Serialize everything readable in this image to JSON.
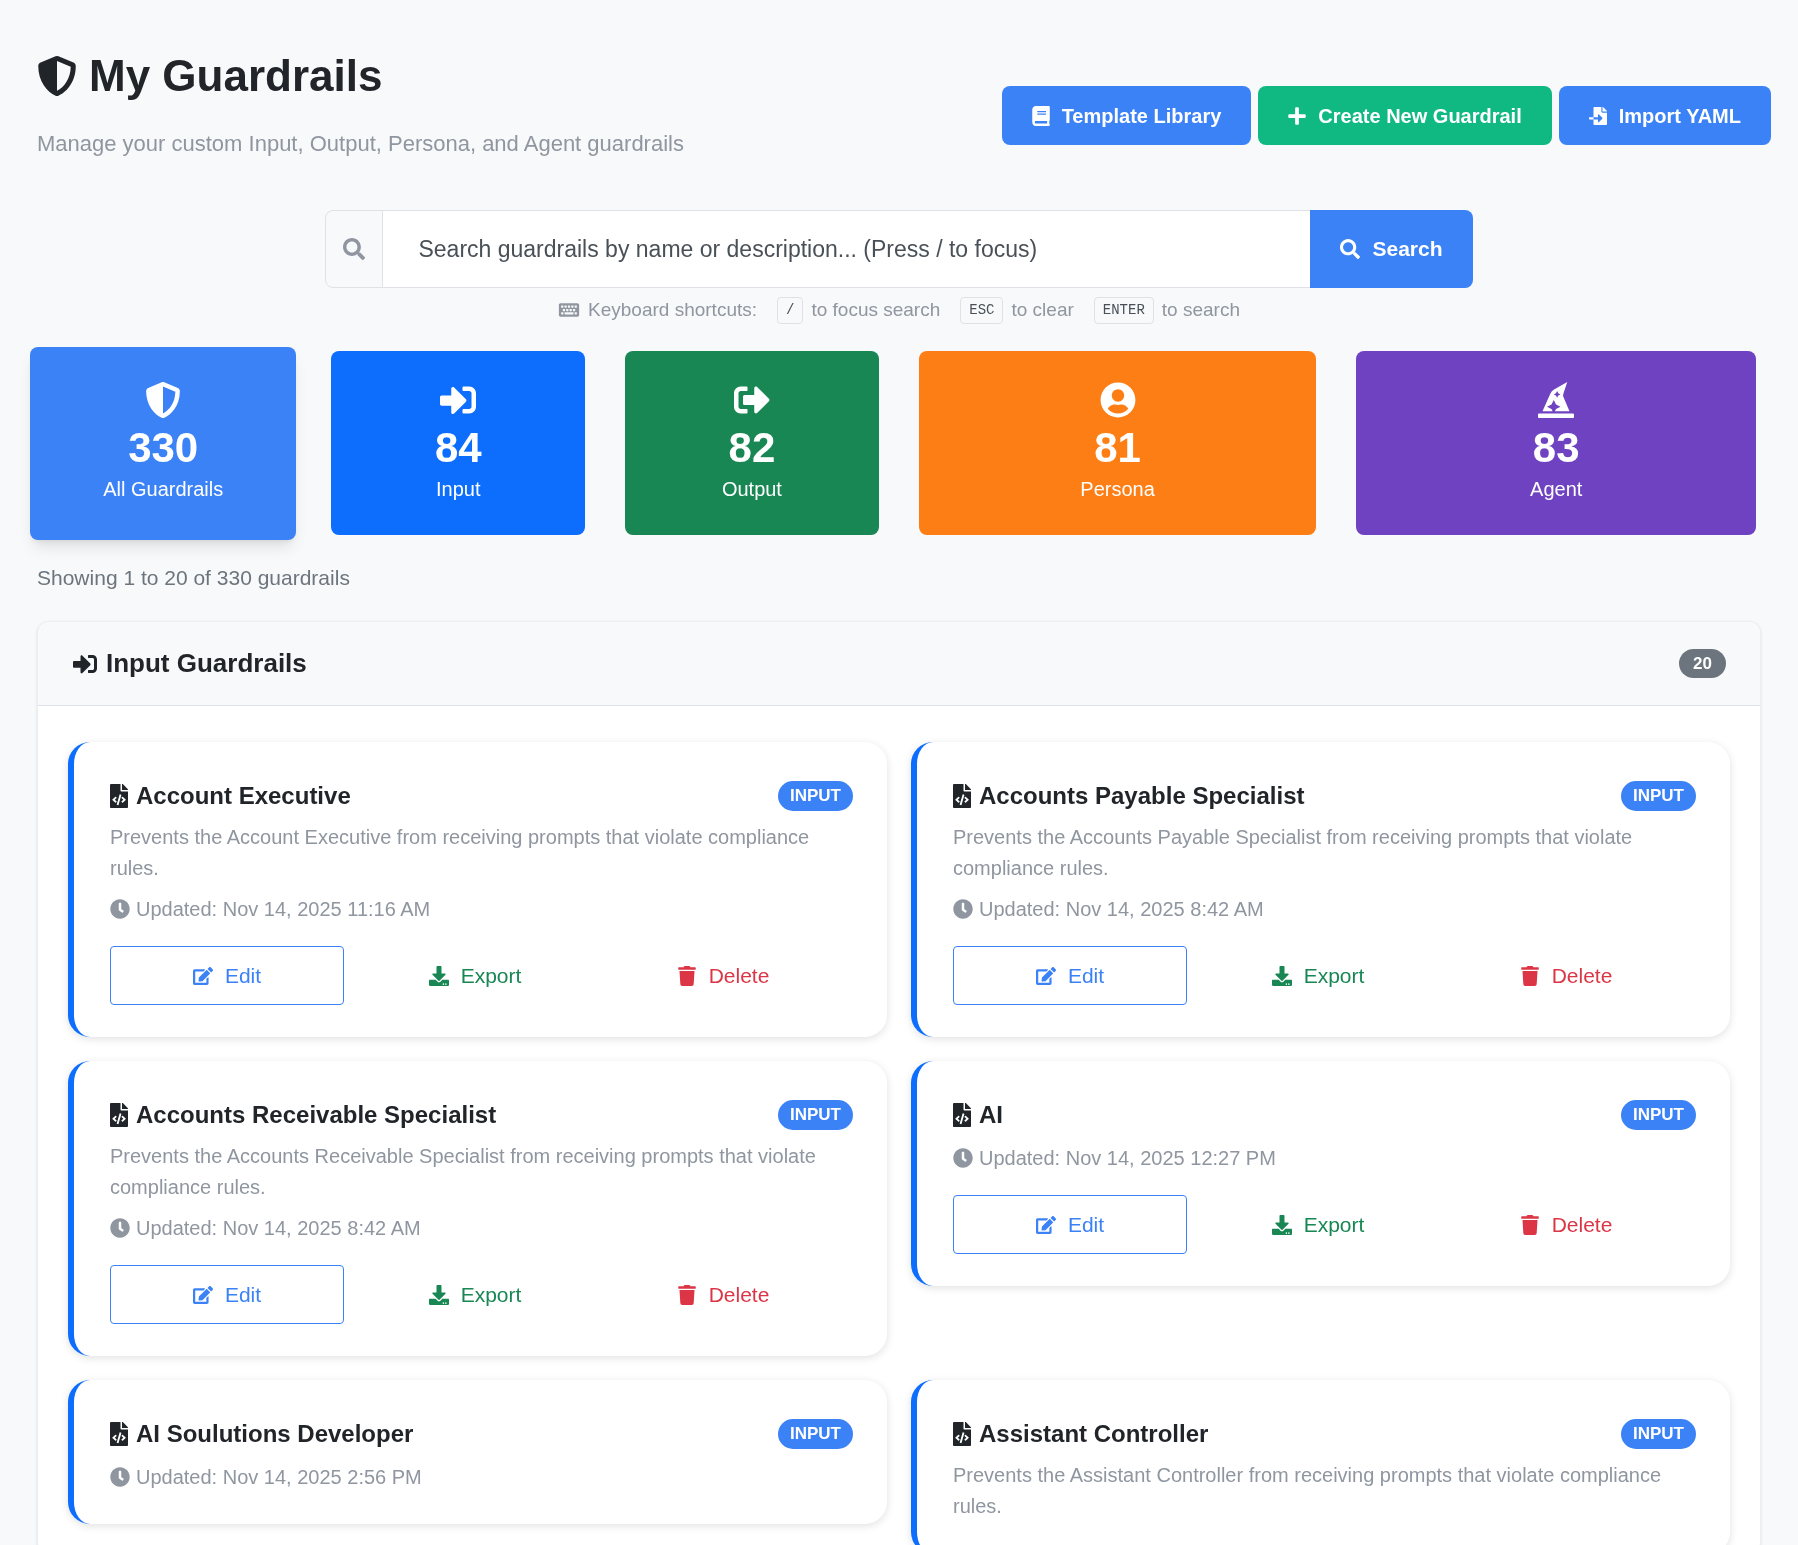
{
  "header": {
    "title": "My Guardrails",
    "subtitle": "Manage your custom Input, Output, Persona, and Agent guardrails"
  },
  "actions": [
    {
      "kind": "library",
      "label": "Template Library"
    },
    {
      "kind": "create",
      "label": "Create New Guardrail"
    },
    {
      "kind": "import",
      "label": "Import YAML"
    }
  ],
  "search": {
    "placeholder": "Search guardrails by name or description... (Press / to focus)",
    "button": "Search"
  },
  "shortcuts": {
    "label": "Keyboard shortcuts:",
    "items": [
      {
        "key": "/",
        "text": "to focus search"
      },
      {
        "key": "ESC",
        "text": "to clear"
      },
      {
        "key": "ENTER",
        "text": "to search"
      }
    ]
  },
  "stats": [
    {
      "kind": "all",
      "count": "330",
      "label": "All Guardrails",
      "selected": true
    },
    {
      "kind": "input",
      "count": "84",
      "label": "Input",
      "selected": false
    },
    {
      "kind": "output",
      "count": "82",
      "label": "Output",
      "selected": false
    },
    {
      "kind": "persona",
      "count": "81",
      "label": "Persona",
      "selected": false
    },
    {
      "kind": "agent",
      "count": "83",
      "label": "Agent",
      "selected": false
    }
  ],
  "showing": "Showing 1 to 20 of 330 guardrails",
  "section": {
    "title": "Input Guardrails",
    "count": "20",
    "cards": [
      {
        "name": "Account Executive",
        "badge": "INPUT",
        "description": "Prevents the Account Executive from receiving prompts that violate compliance rules.",
        "updated": "Updated: Nov 14, 2025 11:16 AM",
        "actions": [
          "Edit",
          "Export",
          "Delete"
        ]
      },
      {
        "name": "Accounts Payable Specialist",
        "badge": "INPUT",
        "description": "Prevents the Accounts Payable Specialist from receiving prompts that violate compliance rules.",
        "updated": "Updated: Nov 14, 2025 8:42 AM",
        "actions": [
          "Edit",
          "Export",
          "Delete"
        ]
      },
      {
        "name": "Accounts Receivable Specialist",
        "badge": "INPUT",
        "description": "Prevents the Accounts Receivable Specialist from receiving prompts that violate compliance rules.",
        "updated": "Updated: Nov 14, 2025 8:42 AM",
        "actions": [
          "Edit",
          "Export",
          "Delete"
        ]
      },
      {
        "name": "AI",
        "badge": "INPUT",
        "updated": "Updated: Nov 14, 2025 12:27 PM",
        "actions": [
          "Edit",
          "Export",
          "Delete"
        ]
      },
      {
        "name": "AI Soulutions Developer",
        "badge": "INPUT",
        "updated": "Updated: Nov 14, 2025 2:56 PM"
      },
      {
        "name": "Assistant Controller",
        "badge": "INPUT",
        "description": "Prevents the Assistant Controller from receiving prompts that violate compliance rules."
      }
    ]
  }
}
